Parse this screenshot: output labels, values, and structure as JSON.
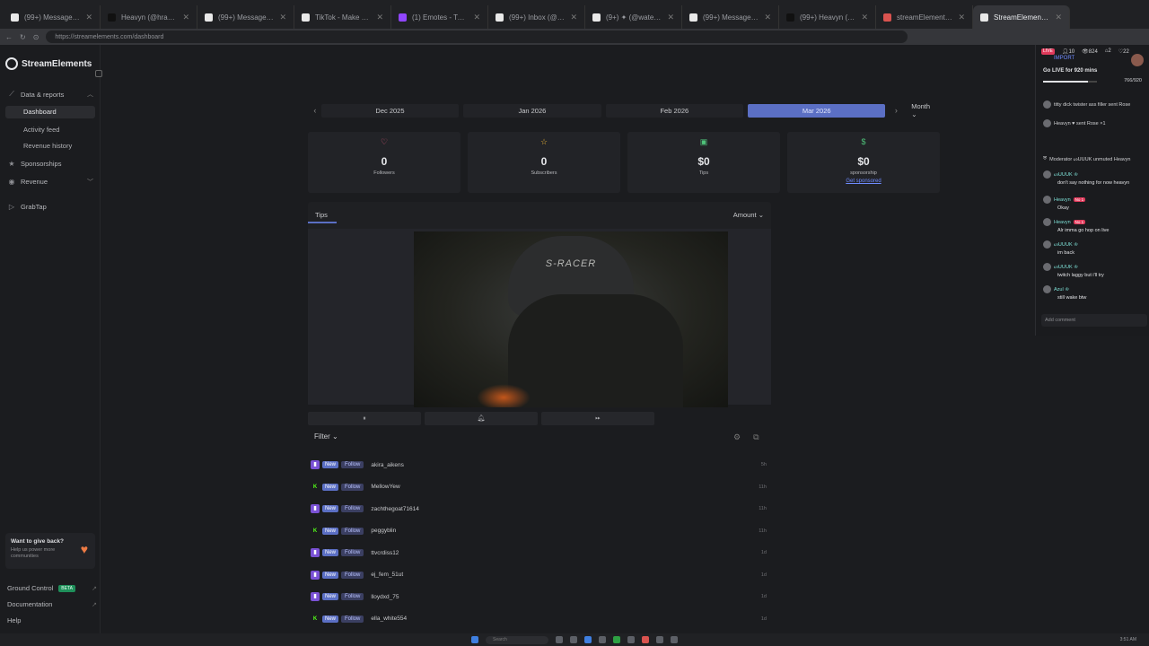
{
  "browser": {
    "tabs": [
      {
        "label": "(99+) Messages | TikTok",
        "fav": "#e9e9e9"
      },
      {
        "label": "Heavyn (@hravyn_wgnk)",
        "fav": "#111111"
      },
      {
        "label": "(99+) Messages | TikTok",
        "fav": "#e9e9e9"
      },
      {
        "label": "TikTok - Make Your Day",
        "fav": "#e9e9e9"
      },
      {
        "label": "(1) Emotes - Twitch",
        "fav": "#9146ff"
      },
      {
        "label": "(99+) Inbox (@yoannes)",
        "fav": "#e9e9e9"
      },
      {
        "label": "(9+) ✦ (@watermelonsteak)",
        "fav": "#e9e9e9"
      },
      {
        "label": "(99+) Messages | TikTok",
        "fav": "#e9e9e9"
      },
      {
        "label": "(99+) Heavyn (@its.nuwe)",
        "fav": "#111111"
      },
      {
        "label": "streamElements - Search",
        "fav": "#d9534f"
      },
      {
        "label": "StreamElements - Dashboard",
        "fav": "#e9e9e9"
      }
    ],
    "url": "https://streamelements.com/dashboard"
  },
  "sidebar": {
    "brand": "StreamElements",
    "data_reports": "Data & reports",
    "dashboard": "Dashboard",
    "activity_feed": "Activity feed",
    "revenue_history": "Revenue history",
    "sponsorships": "Sponsorships",
    "revenue": "Revenue",
    "grabtap": "GrabTap",
    "give_back_title": "Want to give back?",
    "give_back_sub": "Help us power more communities",
    "ground_control": "Ground Control",
    "beta": "BETA",
    "documentation": "Documentation",
    "help": "Help"
  },
  "months": {
    "items": [
      "Dec 2025",
      "Jan 2026",
      "Feb 2026",
      "Mar 2026"
    ],
    "period": "Month"
  },
  "stats": {
    "followers": {
      "value": "0",
      "label": "Followers"
    },
    "subscribers": {
      "value": "0",
      "label": "Subscribers"
    },
    "tips": {
      "value": "$0",
      "label": "Tips"
    },
    "sponsorship": {
      "value": "$0",
      "label": "sponsorship",
      "link": "Get sponsored"
    }
  },
  "chart": {
    "tab": "Tips",
    "metric": "Amount"
  },
  "video": {
    "chair_text": "S-RACER"
  },
  "filter": {
    "label": "Filter"
  },
  "feed": {
    "new_label": "New",
    "follow_label": "Follow",
    "rows": [
      {
        "platform": "twitch",
        "user": "akira_aikens",
        "time": "5h"
      },
      {
        "platform": "kick",
        "user": "MellowYew",
        "time": "11h"
      },
      {
        "platform": "twitch",
        "user": "zachthegoat71614",
        "time": "11h"
      },
      {
        "platform": "kick",
        "user": "peggyblin",
        "time": "11h"
      },
      {
        "platform": "twitch",
        "user": "ttvcrdiss12",
        "time": "1d"
      },
      {
        "platform": "twitch",
        "user": "ej_fem_51ut",
        "time": "1d"
      },
      {
        "platform": "twitch",
        "user": "lloydxd_75",
        "time": "1d"
      },
      {
        "platform": "kick",
        "user": "ella_white554",
        "time": "1d"
      }
    ]
  },
  "chat": {
    "live": "LIVE",
    "viewers_a": "10",
    "viewers_b": "824",
    "gifts": "2",
    "likes": "22",
    "import": "IMPORT",
    "go_live": "Go LIVE for 920 mins",
    "progress_text": "766/920",
    "progress_fraction": 0.83,
    "events": [
      {
        "text": "titty dick twister ass filler sent Rose"
      },
      {
        "text": "Heavyn ♥ sent Rose ×1"
      },
      {
        "text": "Moderator ᔕᑌᑌᑌK unmuted Heavyn"
      }
    ],
    "messages": [
      {
        "name": "ᔕᑌᑌᑌK ♔",
        "text": "don't say nothing for now heavyn"
      },
      {
        "name": "Heavyn",
        "badge": "No 1",
        "text": "Okay"
      },
      {
        "name": "Heavyn",
        "badge": "No 1",
        "text": "Alr imma go hop on live"
      },
      {
        "name": "ᔕᑌᑌᑌK ♔",
        "text": "im back"
      },
      {
        "name": "ᔕᑌᑌᑌK ♔",
        "text": "twitch laggy but i'll try"
      },
      {
        "name": "Azul ♔",
        "text": "still wake btw"
      }
    ],
    "add_comment": "Add comment"
  },
  "taskbar": {
    "search": "Search",
    "time": "3:51 AM"
  }
}
